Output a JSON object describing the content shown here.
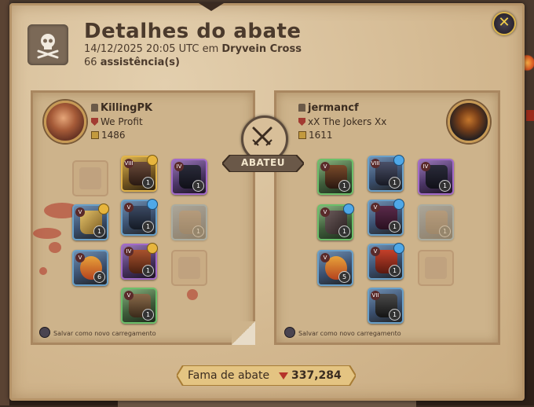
{
  "header": {
    "title": "Detalhes do abate",
    "datetime": "14/12/2025 20:05 UTC",
    "location_prefix": "em",
    "location": "Dryvein Cross",
    "assists_count": "66",
    "assists_label": "assistência(s)"
  },
  "killer": {
    "name": "KillingPK",
    "guild": "We Profit",
    "item_power": "1486",
    "save_loadout_label": "Salvar como novo carregamento"
  },
  "victim": {
    "name": "jermancf",
    "guild": "xX The Jokers Xx",
    "item_power": "1611",
    "save_loadout_label": "Salvar como novo carregamento"
  },
  "verdict_label": "ABATEU",
  "fame": {
    "label": "Fama de abate",
    "value": "337,284"
  },
  "killer_items": [
    {
      "slot": "head",
      "tier": "VIII",
      "qty": "1",
      "rarity": "gold",
      "ench": "gold"
    },
    {
      "slot": "cape",
      "tier": "IV",
      "qty": "1",
      "rarity": "purple",
      "ench": ""
    },
    {
      "slot": "weapon",
      "tier": "V",
      "qty": "1",
      "rarity": "blue",
      "ench": "gold"
    },
    {
      "slot": "chest",
      "tier": "V",
      "qty": "1",
      "rarity": "blue",
      "ench": "blue"
    },
    {
      "slot": "offhand",
      "tier": "",
      "qty": "1",
      "rarity": "blue",
      "ench": ""
    },
    {
      "slot": "potion",
      "tier": "V",
      "qty": "6",
      "rarity": "blue",
      "ench": ""
    },
    {
      "slot": "shoes",
      "tier": "IV",
      "qty": "1",
      "rarity": "purple",
      "ench": "gold"
    },
    {
      "slot": "mount",
      "tier": "V",
      "qty": "1",
      "rarity": "green",
      "ench": ""
    }
  ],
  "victim_items": [
    {
      "slot": "bag",
      "tier": "V",
      "qty": "1",
      "rarity": "green",
      "ench": ""
    },
    {
      "slot": "head",
      "tier": "VIII",
      "qty": "1",
      "rarity": "blue",
      "ench": "blue"
    },
    {
      "slot": "cape",
      "tier": "IV",
      "qty": "1",
      "rarity": "purple",
      "ench": ""
    },
    {
      "slot": "weapon",
      "tier": "V",
      "qty": "1",
      "rarity": "green",
      "ench": "blue"
    },
    {
      "slot": "chest",
      "tier": "V",
      "qty": "1",
      "rarity": "blue",
      "ench": "blue"
    },
    {
      "slot": "offhand",
      "tier": "",
      "qty": "1",
      "rarity": "blue",
      "ench": ""
    },
    {
      "slot": "potion",
      "tier": "V",
      "qty": "5",
      "rarity": "blue",
      "ench": ""
    },
    {
      "slot": "shoes",
      "tier": "V",
      "qty": "1",
      "rarity": "blue",
      "ench": "blue"
    },
    {
      "slot": "mount",
      "tier": "VII",
      "qty": "1",
      "rarity": "blue",
      "ench": ""
    }
  ]
}
